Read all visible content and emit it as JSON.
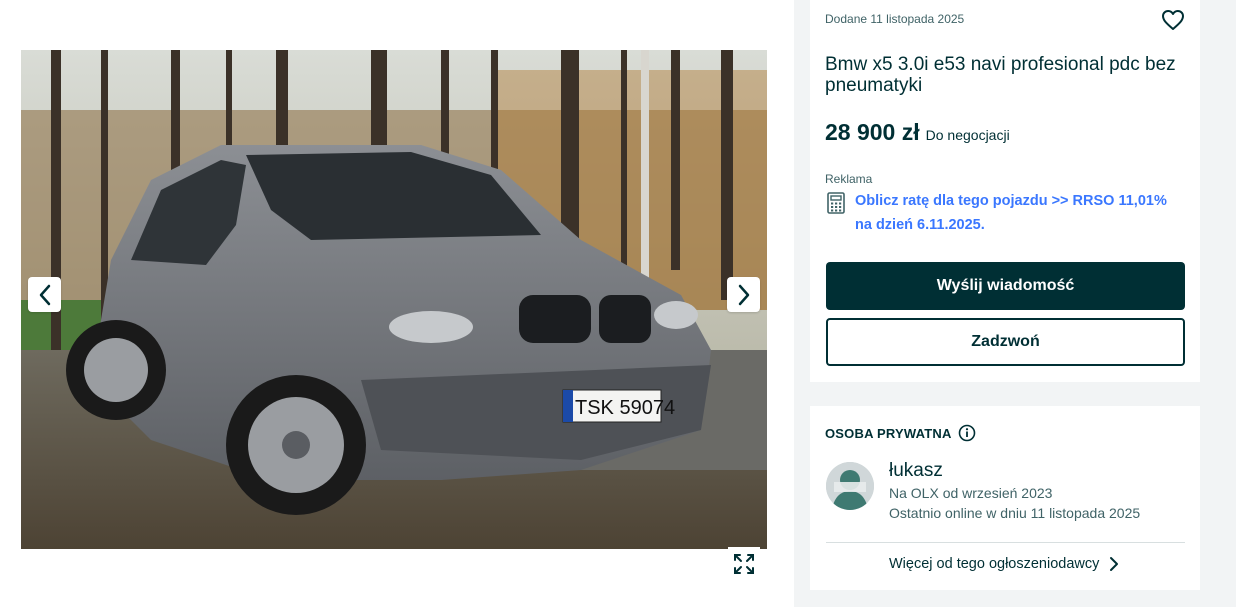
{
  "gallery": {
    "photo_alt": "",
    "plate_text": "TSK 59074"
  },
  "listing": {
    "posted": "Dodane 11 listopada 2025",
    "title": "Bmw x5 3.0i e53 navi profesional pdc bez pneumatyki",
    "price": "28 900 zł",
    "negotiable": "Do negocjacji",
    "ad_label": "Reklama",
    "calculator_link": "Oblicz ratę dla tego pojazdu >> RRSO 11,01% na dzień 6.11.2025.",
    "message_button": "Wyślij wiadomość",
    "call_button": "Zadzwoń"
  },
  "seller": {
    "type_label": "OSOBA PRYWATNA",
    "name": "łukasz",
    "since": "Na OLX od wrzesień 2023",
    "last_online": "Ostatnio online w dniu 11 listopada 2025",
    "more_link": "Więcej od tego ogłoszeniodawcy"
  },
  "icons": {
    "prev": "chevron-left-icon",
    "next": "chevron-right-icon",
    "expand": "expand-icon",
    "favorite": "heart-icon",
    "calculator": "calculator-icon",
    "info": "info-icon",
    "more": "chevron-right-icon"
  },
  "colors": {
    "brand_dark": "#002f34",
    "link_blue": "#3a77ff",
    "muted": "#406367",
    "page_bg": "#f2f4f5"
  }
}
